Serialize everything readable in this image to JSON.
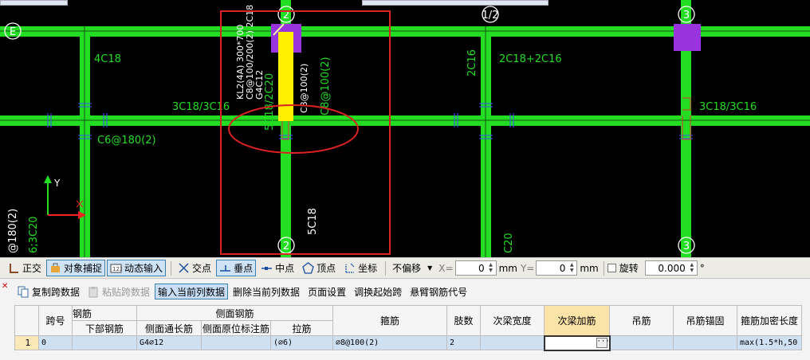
{
  "canvas": {
    "axis_labels": [
      "E",
      "2",
      "1/2",
      "3",
      "2",
      "3"
    ],
    "beam_labels": {
      "left_vertical": "4C18",
      "left_horizontal": "3C18/3C16",
      "left_stirrup": "C6@180(2)",
      "beam_spec_1": "KL2(4A) 300*700",
      "beam_spec_2": "C8@100/200(2) 2C18",
      "beam_spec_3": "G4C12",
      "beam_side_1": "5C18/2C20",
      "beam_side_2": "C8@100(2)",
      "beam_side_3": "C8@100(2)",
      "beam_bottom": "5C18",
      "mid_vertical": "2C16",
      "mid_horizontal": "2C18+2C16",
      "right_horizontal": "3C18/3C16",
      "mid_bottom": "C20",
      "left_edge_1": "@180(2)",
      "left_edge_2": "6;3C20"
    },
    "ucs_y": "Y"
  },
  "snapbar": {
    "ortho": "正交",
    "osnap": "对象捕捉",
    "dyninput": "动态输入",
    "intersect": "交点",
    "perp": "垂点",
    "mid": "中点",
    "vertex": "顶点",
    "coord": "坐标",
    "offset_select": "不偏移",
    "x_label": "X=",
    "x_value": "0",
    "y_label": "Y=",
    "y_value": "0",
    "unit": "mm",
    "rotate": "旋转",
    "rotate_value": "0.000",
    "degree": "°"
  },
  "toolbar": {
    "copy": "复制跨数据",
    "paste": "粘贴跨数据",
    "input_col": "输入当前列数据",
    "delete_col": "删除当前列数据",
    "page_setup": "页面设置",
    "swap_start": "调换起始跨",
    "cantilever": "悬臂钢筋代号"
  },
  "table": {
    "headers_top": [
      "跨号",
      "钢筋",
      "侧面钢筋",
      "箍筋",
      "肢数",
      "次梁宽度",
      "次梁加筋",
      "吊筋",
      "吊筋锚固",
      "箍筋加密长度"
    ],
    "headers_sub": [
      "下部钢筋",
      "侧面通长筋",
      "侧面原位标注筋",
      "拉筋"
    ],
    "rows": [
      {
        "row_no": "1",
        "span": "0",
        "bottom": "",
        "side_long": "G4⌀12",
        "side_orig": "",
        "tie": "(⌀6)",
        "stirrup": "⌀8@100(2)",
        "legs": "2",
        "sec_width": "",
        "sec_add": "",
        "hanger": "",
        "hanger_anchor": "",
        "dense_len": "max(1.5*h,50"
      }
    ]
  }
}
